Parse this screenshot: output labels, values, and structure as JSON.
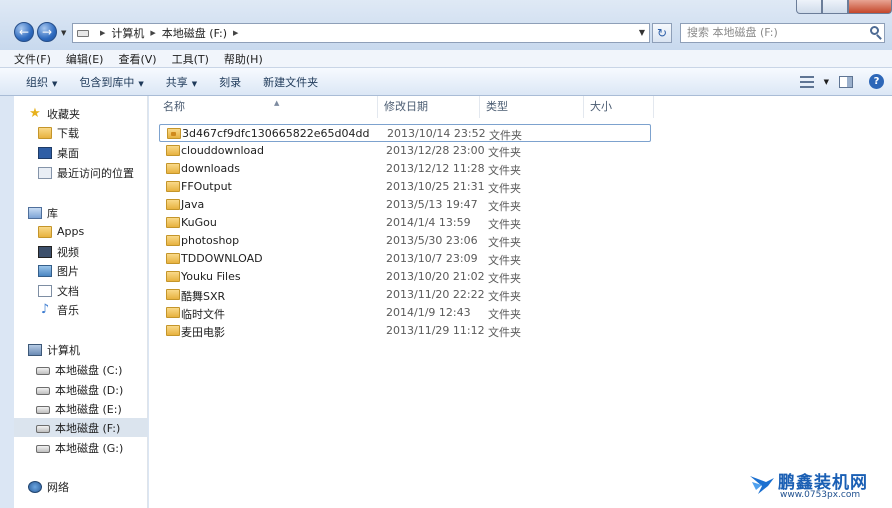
{
  "address": {
    "crumbs": [
      "计算机",
      "本地磁盘 (F:)"
    ],
    "search_placeholder": "搜索 本地磁盘 (F:)"
  },
  "menubar": [
    "文件(F)",
    "编辑(E)",
    "查看(V)",
    "工具(T)",
    "帮助(H)"
  ],
  "toolbar": {
    "organize": "组织",
    "include_library": "包含到库中",
    "share": "共享",
    "burn": "刻录",
    "new_folder": "新建文件夹"
  },
  "navpane": {
    "favorites": "收藏夹",
    "downloads": "下载",
    "desktop": "桌面",
    "recent": "最近访问的位置",
    "libraries": "库",
    "apps": "Apps",
    "videos": "视频",
    "pictures": "图片",
    "documents": "文档",
    "music": "音乐",
    "computer": "计算机",
    "drive_c": "本地磁盘 (C:)",
    "drive_d": "本地磁盘 (D:)",
    "drive_e": "本地磁盘 (E:)",
    "drive_f": "本地磁盘 (F:)",
    "drive_g": "本地磁盘 (G:)",
    "network": "网络"
  },
  "columns": {
    "name": "名称",
    "date": "修改日期",
    "type": "类型",
    "size": "大小"
  },
  "files": [
    {
      "name": "3d467cf9dfc130665822e65d04dd",
      "date": "2013/10/14 23:52",
      "type": "文件夹"
    },
    {
      "name": "clouddownload",
      "date": "2013/12/28 23:00",
      "type": "文件夹"
    },
    {
      "name": "downloads",
      "date": "2013/12/12 11:28",
      "type": "文件夹"
    },
    {
      "name": "FFOutput",
      "date": "2013/10/25 21:31",
      "type": "文件夹"
    },
    {
      "name": "Java",
      "date": "2013/5/13 19:47",
      "type": "文件夹"
    },
    {
      "name": "KuGou",
      "date": "2014/1/4 13:59",
      "type": "文件夹"
    },
    {
      "name": "photoshop",
      "date": "2013/5/30 23:06",
      "type": "文件夹"
    },
    {
      "name": "TDDOWNLOAD",
      "date": "2013/10/7 23:09",
      "type": "文件夹"
    },
    {
      "name": "Youku Files",
      "date": "2013/10/20 21:02",
      "type": "文件夹"
    },
    {
      "name": "酷舞SXR",
      "date": "2013/11/20 22:22",
      "type": "文件夹"
    },
    {
      "name": "临时文件",
      "date": "2014/1/9 12:43",
      "type": "文件夹"
    },
    {
      "name": "麦田电影",
      "date": "2013/11/29 11:12",
      "type": "文件夹"
    }
  ],
  "watermark": {
    "title": "鹏鑫装机网",
    "url": "www.0753px.com"
  }
}
